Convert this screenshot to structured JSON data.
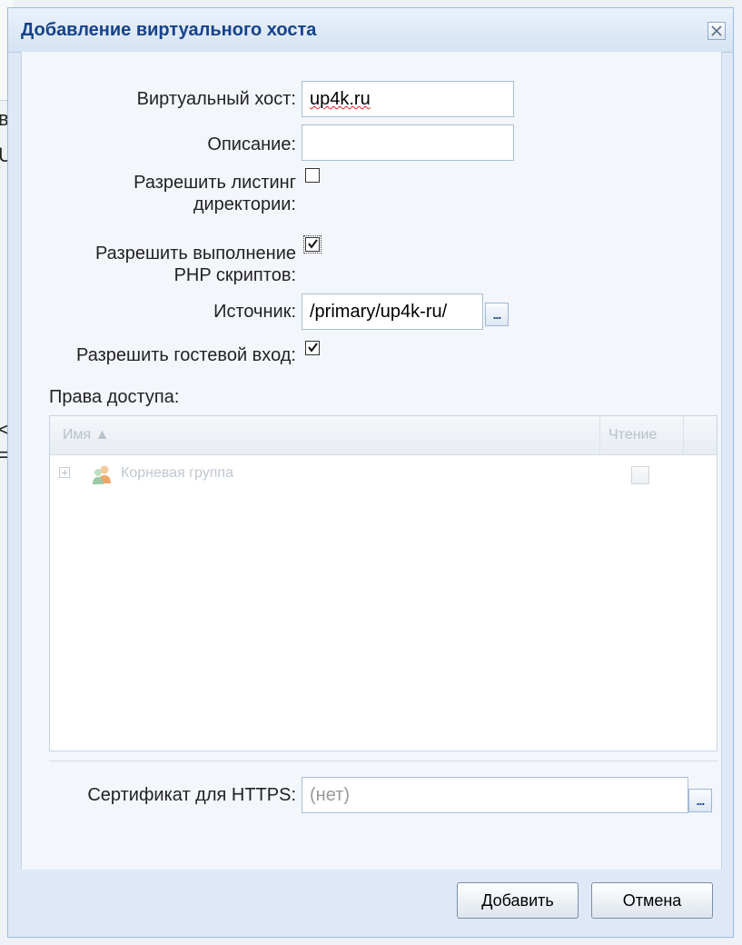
{
  "dialog": {
    "title": "Добавление виртуального хоста",
    "close_icon": "close-icon"
  },
  "form": {
    "vhost_label": "Виртуальный хост:",
    "vhost_value": "up4k.ru",
    "description_label": "Описание:",
    "description_value": "",
    "dir_listing_label_line1": "Разрешить листинг",
    "dir_listing_label_line2": "директории:",
    "dir_listing_checked": false,
    "php_label_line1": "Разрешить выполнение",
    "php_label_line2": "PHP скриптов:",
    "php_checked": true,
    "source_label": "Источник:",
    "source_value": "/primary/up4k-ru/",
    "guest_label": "Разрешить гостевой вход:",
    "guest_checked": true,
    "access_rights_label": "Права доступа:",
    "browse_label": "..."
  },
  "grid": {
    "columns": [
      "Имя ▲",
      "Чтение"
    ],
    "rows": [
      {
        "label": "Корневая группа",
        "icon": "user-group-icon",
        "read": false
      }
    ]
  },
  "https": {
    "label": "Сертификат для HTTPS:",
    "placeholder": "(нет)"
  },
  "buttons": {
    "add": "Добавить",
    "cancel": "Отмена"
  },
  "colors": {
    "title": "#15428b",
    "dialog_bg": "#dfe8f6",
    "border": "#99bbe8"
  }
}
